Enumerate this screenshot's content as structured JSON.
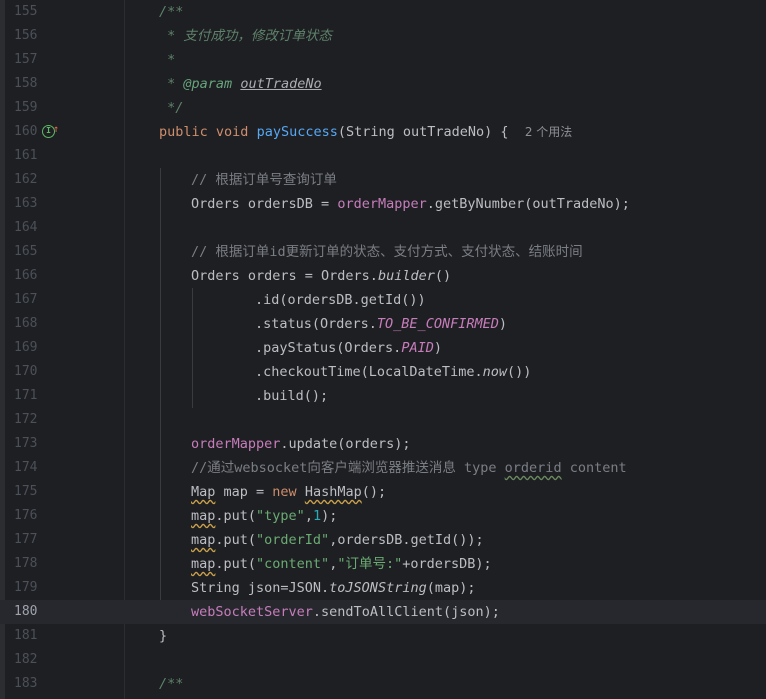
{
  "editor": {
    "current_line": "180",
    "lines": [
      {
        "no": "155"
      },
      {
        "no": "156"
      },
      {
        "no": "157"
      },
      {
        "no": "158"
      },
      {
        "no": "159"
      },
      {
        "no": "160"
      },
      {
        "no": "161"
      },
      {
        "no": "162"
      },
      {
        "no": "163"
      },
      {
        "no": "164"
      },
      {
        "no": "165"
      },
      {
        "no": "166"
      },
      {
        "no": "167"
      },
      {
        "no": "168"
      },
      {
        "no": "169"
      },
      {
        "no": "170"
      },
      {
        "no": "171"
      },
      {
        "no": "172"
      },
      {
        "no": "173"
      },
      {
        "no": "174"
      },
      {
        "no": "175"
      },
      {
        "no": "176"
      },
      {
        "no": "177"
      },
      {
        "no": "178"
      },
      {
        "no": "179"
      },
      {
        "no": "180"
      },
      {
        "no": "181"
      },
      {
        "no": "182"
      },
      {
        "no": "183"
      }
    ],
    "gutter_icon": "implementation-up-icon",
    "gutter_icon_glyph": "I",
    "gutter_icon_arrow": "↑",
    "code": {
      "l155": "/**",
      "l156": " * 支付成功，修改订单状态",
      "l157": " *",
      "l158_star": " * ",
      "l158_tag": "@param",
      "l158_param": "outTradeNo",
      "l159": " */",
      "l160_kw1": "public",
      "l160_kw2": "void",
      "l160_fn": "paySuccess",
      "l160_rest": "(String outTradeNo) {",
      "l160_hint": "2 个用法",
      "l162": "// 根据订单号查询订单",
      "l163_a": "Orders ordersDB = ",
      "l163_field": "orderMapper",
      "l163_b": ".getByNumber(outTradeNo);",
      "l165": "// 根据订单id更新订单的状态、支付方式、支付状态、结账时间",
      "l166_a": "Orders orders = Orders.",
      "l166_static": "builder",
      "l166_b": "()",
      "l167": ".id(ordersDB.getId())",
      "l168_a": ".status(Orders.",
      "l168_const": "TO_BE_CONFIRMED",
      "l168_b": ")",
      "l169_a": ".payStatus(Orders.",
      "l169_const": "PAID",
      "l169_b": ")",
      "l170_a": ".checkoutTime(LocalDateTime.",
      "l170_static": "now",
      "l170_b": "())",
      "l171": ".build();",
      "l173_field": "orderMapper",
      "l173_b": ".update(orders);",
      "l174_a": "//通过websocket向客户端浏览器推送消息 type ",
      "l174_b": "orderid",
      "l174_c": " content",
      "l175_a": "Map",
      "l175_b": " map = ",
      "l175_kw": "new",
      "l175_c": " ",
      "l175_d": "HashMap",
      "l175_e": "();",
      "l176_a": "map",
      "l176_b": ".put(",
      "l176_str": "\"type\"",
      "l176_c": ",",
      "l176_num": "1",
      "l176_d": ");",
      "l177_a": "map",
      "l177_b": ".put(",
      "l177_str": "\"orderId\"",
      "l177_c": ",ordersDB.getId());",
      "l178_a": "map",
      "l178_b": ".put(",
      "l178_str1": "\"content\"",
      "l178_c": ",",
      "l178_str2": "\"订单号:\"",
      "l178_d": "+ordersDB);",
      "l179_a": "String json=JSON.",
      "l179_static": "toJSONString",
      "l179_b": "(map);",
      "l180_field": "webSocketServer",
      "l180_b": ".sendToAllClient(json);",
      "l181": "}",
      "l183": "/**"
    }
  }
}
